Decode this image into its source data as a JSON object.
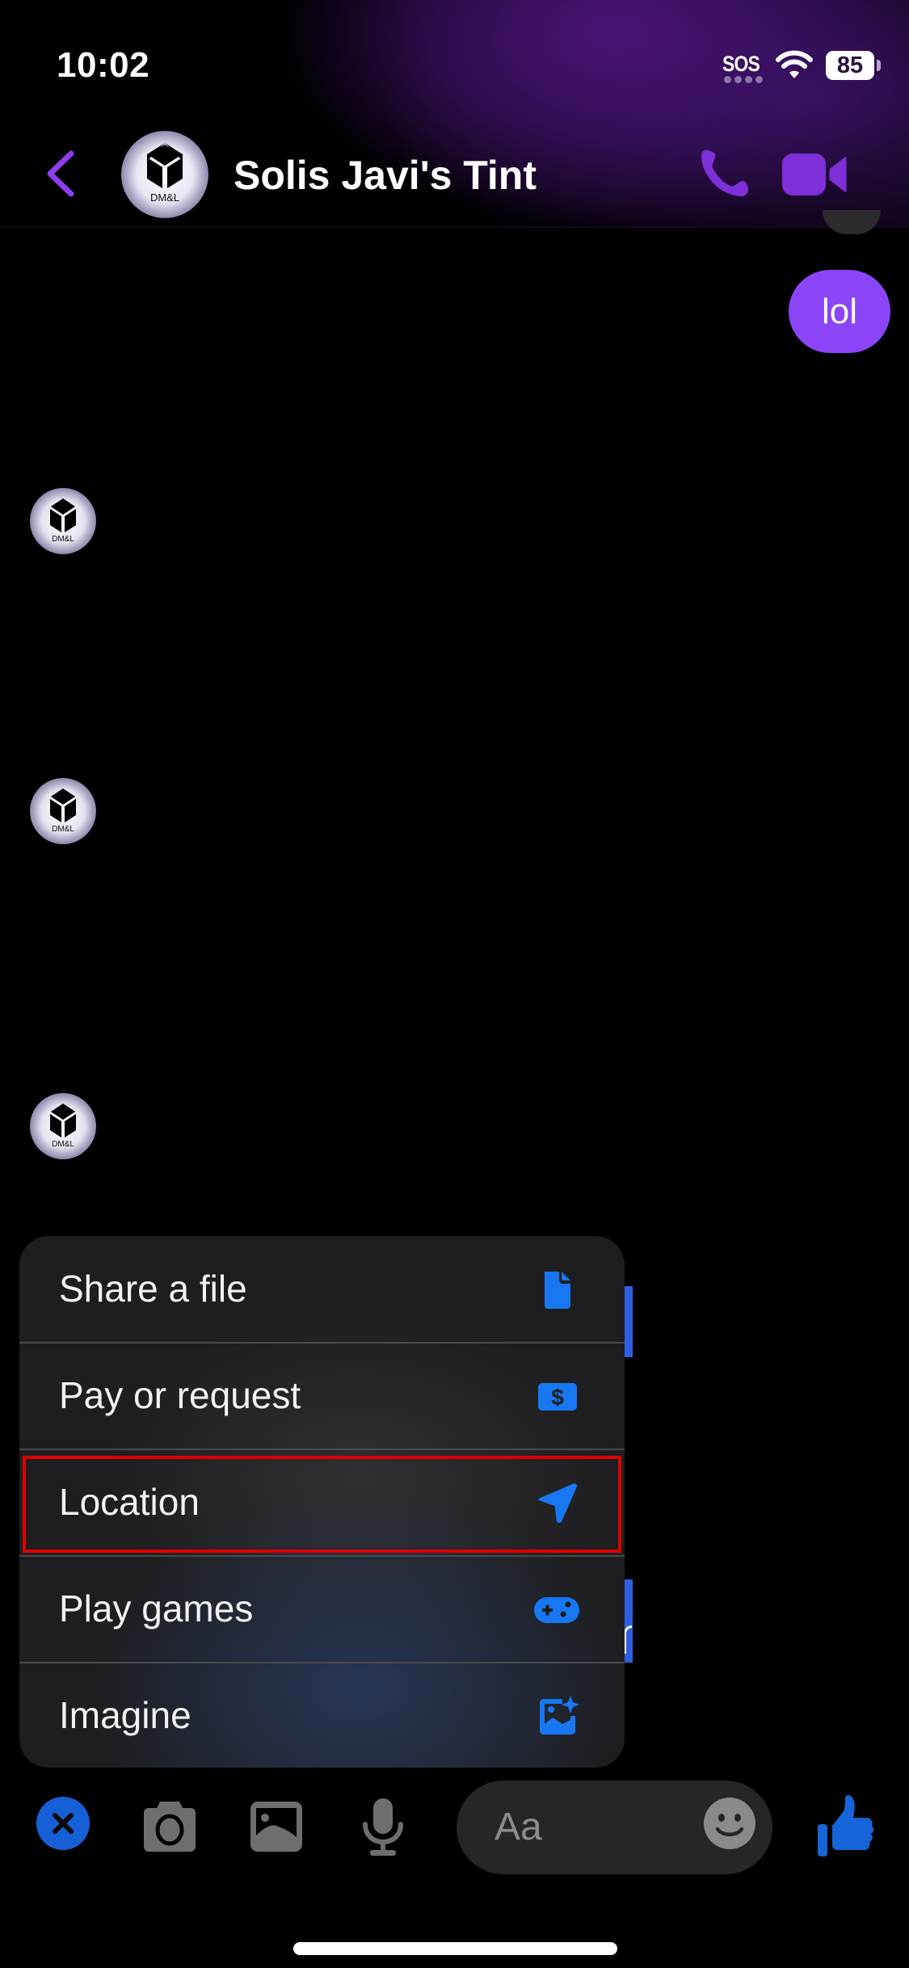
{
  "status_bar": {
    "time": "10:02",
    "carrier": "SOS",
    "battery": "85"
  },
  "header": {
    "title": "Solis Javi's Tint",
    "avatar_label": "DM&L",
    "accent_color": "#7e2fd6"
  },
  "messages": [
    {
      "from": "me",
      "text": "lol",
      "color": "#8b44f7"
    }
  ],
  "contact_avatars": [
    "DM&L",
    "DM&L",
    "DM&L"
  ],
  "attachment_menu": {
    "icon_color": "#1877f2",
    "highlighted_item": "Location",
    "items": [
      {
        "label": "Share a file",
        "icon": "file-icon"
      },
      {
        "label": "Pay or request",
        "icon": "dollar-card-icon"
      },
      {
        "label": "Location",
        "icon": "location-arrow-icon"
      },
      {
        "label": "Play games",
        "icon": "gamepad-icon"
      },
      {
        "label": "Imagine",
        "icon": "sparkle-image-icon"
      }
    ]
  },
  "composer": {
    "placeholder": "Aa",
    "close_color": "#1560d6",
    "like_color": "#1565d8"
  }
}
